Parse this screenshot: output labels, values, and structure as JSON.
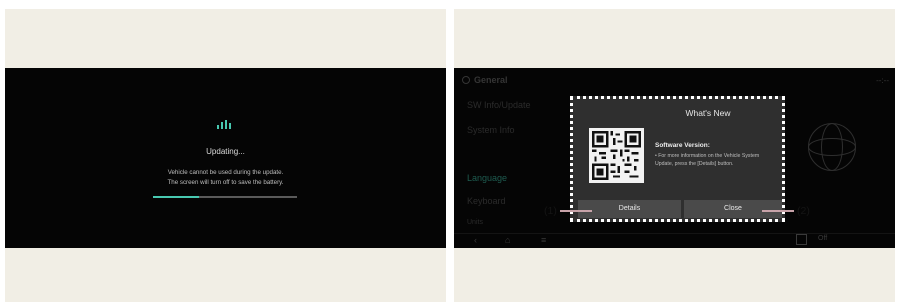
{
  "left_screen": {
    "title": "Updating...",
    "message_line1": "Vehicle cannot be used during the update.",
    "message_line2": "The screen will turn off to save the battery.",
    "progress": 0.32,
    "accent_color": "#48c8b0"
  },
  "right_screen": {
    "menu": {
      "header": "General",
      "items": [
        "SW Info/Update",
        "System Info",
        "Language",
        "Keyboard",
        "Units"
      ]
    },
    "top_right": "--:--",
    "bottom_bar": {
      "icons": [
        "back-icon",
        "home-icon",
        "menu-icon",
        "toggle-box-icon"
      ],
      "off_label": "Off"
    },
    "popup": {
      "title": "What's New",
      "software_version_label": "Software Version:",
      "description": "• For more information on the Vehicle System Update, press the [Details] button.",
      "details_button": "Details",
      "close_button": "Close"
    },
    "callouts": [
      "(1)",
      "(2)"
    ]
  }
}
